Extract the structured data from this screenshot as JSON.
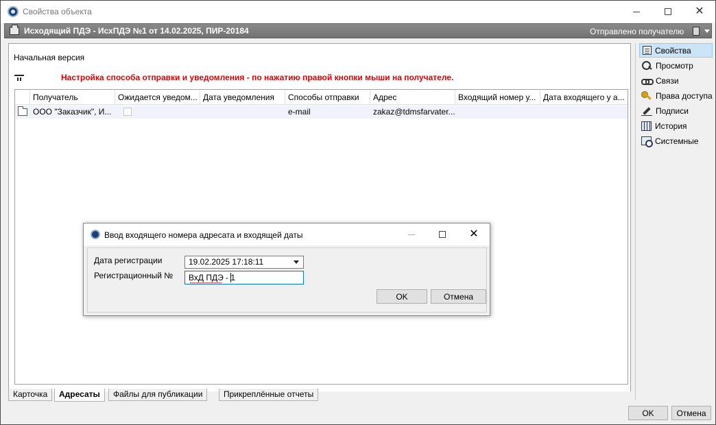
{
  "window": {
    "title": "Свойства объекта"
  },
  "object": {
    "title": "Исходящий ПДЭ - ИсхПДЭ №1 от 14.02.2025, ПИР-20184",
    "status": "Отправлено получателю"
  },
  "main": {
    "version_label": "Начальная версия",
    "hint": "Настройка способа отправки и уведомления - по нажатию правой кнопки мыши на получателе.",
    "columns": [
      "Получатель",
      "Ожидается уведом...",
      "Дата уведомления",
      "Способы отправки",
      "Адрес",
      "Входящий номер у...",
      "Дата входящего у а..."
    ],
    "rows": [
      {
        "recipient": "ООО \"Заказчик\", И...",
        "notify_expected": false,
        "notify_date": "",
        "send_method": "e-mail",
        "address": "zakaz@tdmsfarvater....",
        "incoming_number": "",
        "incoming_date": ""
      }
    ]
  },
  "tabs": [
    {
      "label": "Карточка",
      "active": false
    },
    {
      "label": "Адресаты",
      "active": true
    },
    {
      "label": "Файлы для публикации",
      "active": false
    },
    {
      "label": "Прикреплённые отчеты",
      "active": false
    }
  ],
  "side": {
    "items": [
      {
        "label": "Свойства",
        "icon": "properties-icon",
        "active": true
      },
      {
        "label": "Просмотр",
        "icon": "magnifier-icon",
        "active": false
      },
      {
        "label": "Связи",
        "icon": "links-icon",
        "active": false
      },
      {
        "label": "Права доступа",
        "icon": "key-icon",
        "active": false
      },
      {
        "label": "Подписи",
        "icon": "pen-icon",
        "active": false
      },
      {
        "label": "История",
        "icon": "history-icon",
        "active": false
      },
      {
        "label": "Системные",
        "icon": "system-icon",
        "active": false
      }
    ]
  },
  "buttons": {
    "ok": "OK",
    "cancel": "Отмена"
  },
  "dialog": {
    "title": "Ввод входящего номера адресата и входящей даты",
    "date_label": "Дата регистрации",
    "date_value": "19.02.2025 17:18:11",
    "reg_label": "Регистрационный №",
    "reg_value": "ВхД ПДЭ - 1",
    "ok": "OK",
    "cancel": "Отмена"
  },
  "colors": {
    "hint": "#e00000",
    "header_bar": "#7e7e7e",
    "side_active": "#cce4f7",
    "focus_border": "#0078d7"
  }
}
